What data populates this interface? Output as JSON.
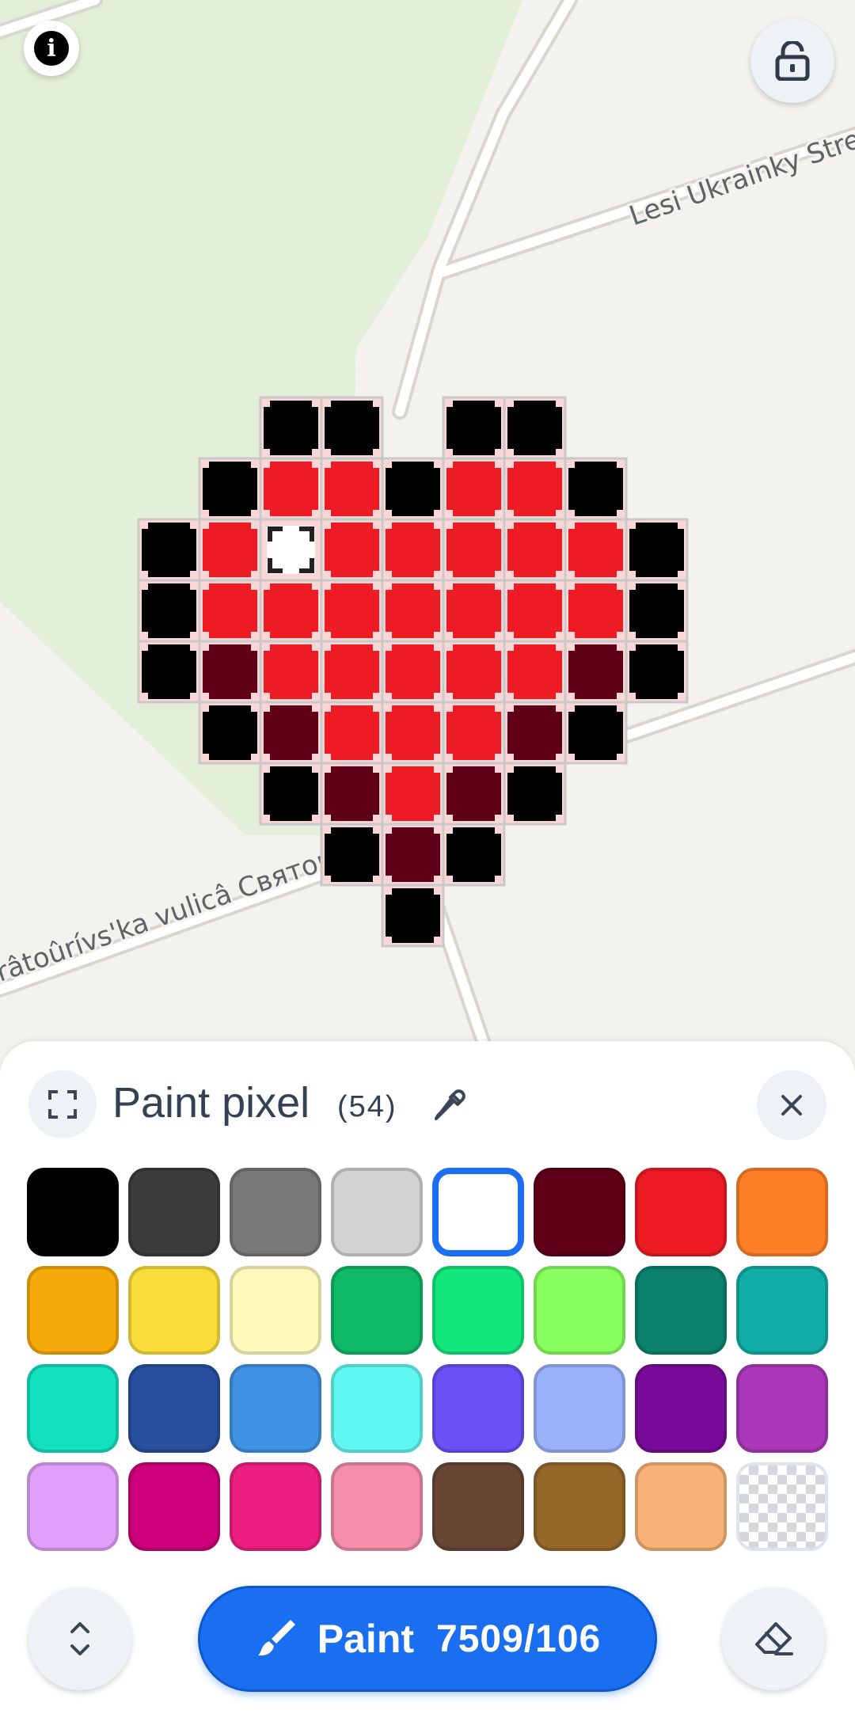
{
  "map": {
    "streets": [
      "Lesi Ukrainky Stree",
      "râtoûrívs'ka vulicâ Святоюр"
    ],
    "colors": {
      "background": "#f4f2ee",
      "park": "#e4efd9",
      "road": "#ffffff",
      "road_edge": "#d9d6d0"
    }
  },
  "pixel_art": {
    "description_colors": {
      "outline": "#000000",
      "red": "#ed1c24",
      "dark_red": "#600018",
      "empty": "#ffffff"
    },
    "rows": [
      "..KK.KK..",
      ".KRRKRRK.",
      "KRWRRRRRK",
      "KRRRRRRRK",
      "KDRRRRRDK",
      ".KDRRRDK.",
      "..KDRDK..",
      "...KDK...",
      "....K...."
    ]
  },
  "top_buttons": {
    "info_icon": "info-icon",
    "lock_icon": "lock-open-icon"
  },
  "panel": {
    "title": "Paint pixel",
    "count": "(54)",
    "picker_icon": "eyedropper-icon",
    "close_icon": "close-icon",
    "expand_icon": "fullscreen-icon",
    "selected_color": "#ffffff",
    "palette": [
      "#000000",
      "#3c3c3c",
      "#787878",
      "#d2d2d2",
      "#ffffff",
      "#600018",
      "#ed1c24",
      "#ff7f27",
      "#f6aa09",
      "#f9dd3b",
      "#fffabc",
      "#0eb968",
      "#13e67b",
      "#87ff5e",
      "#0c816e",
      "#10aea6",
      "#13e1be",
      "#28509e",
      "#4093e4",
      "#60f7f2",
      "#6b50f6",
      "#99b1fb",
      "#780c99",
      "#aa38b9",
      "#e09ff9",
      "#cb007a",
      "#ec1f80",
      "#f38da9",
      "#684634",
      "#95682a",
      "#f8b277",
      "transparent"
    ]
  },
  "bottom_bar": {
    "paint_label": "Paint",
    "charges": "7509/106",
    "paint_icon": "brush-icon",
    "scroll_icon": "chevron-up-down-icon",
    "eraser_icon": "eraser-icon"
  }
}
